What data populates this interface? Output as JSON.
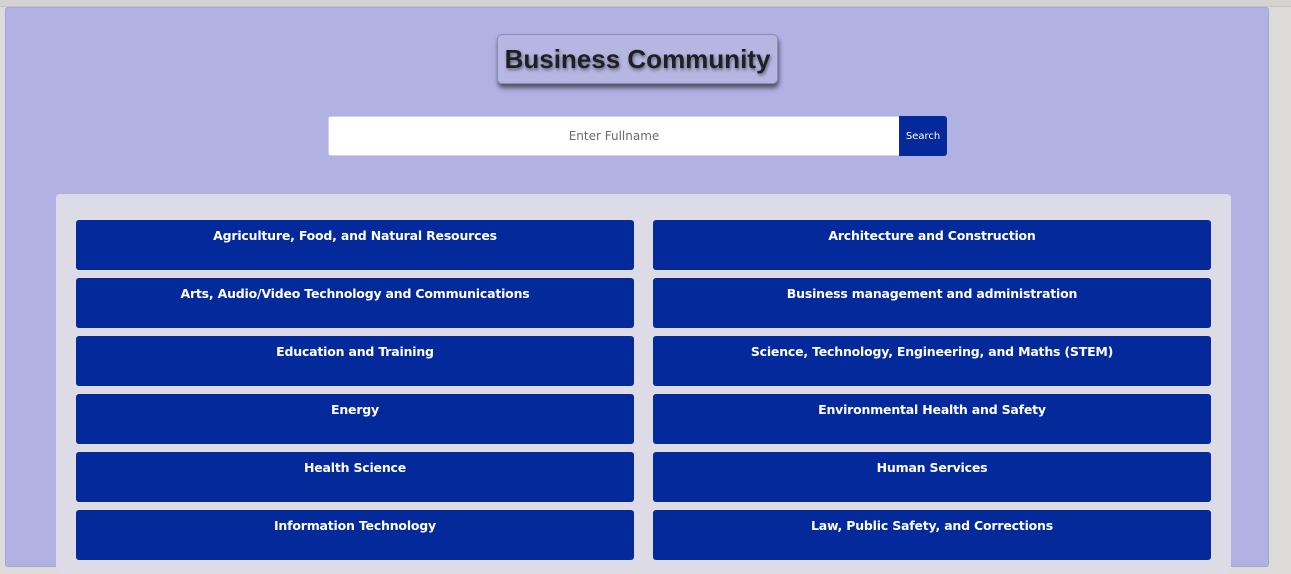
{
  "header": {
    "title": "Business Community"
  },
  "search": {
    "placeholder": "Enter Fullname",
    "value": "",
    "button_label": "Search"
  },
  "categories": [
    {
      "label": "Agriculture, Food, and Natural Resources"
    },
    {
      "label": "Architecture and Construction"
    },
    {
      "label": "Arts, Audio/Video Technology and Communications"
    },
    {
      "label": "Business management and administration"
    },
    {
      "label": "Education and Training"
    },
    {
      "label": "Science, Technology, Engineering, and Maths (STEM)"
    },
    {
      "label": "Energy"
    },
    {
      "label": "Environmental Health and Safety"
    },
    {
      "label": "Health Science"
    },
    {
      "label": "Human Services"
    },
    {
      "label": "Information Technology"
    },
    {
      "label": "Law, Public Safety, and Corrections"
    }
  ],
  "colors": {
    "page_background": "#b1b1e4",
    "panel_background": "#dcdbe6",
    "button_blue": "#04299a"
  }
}
